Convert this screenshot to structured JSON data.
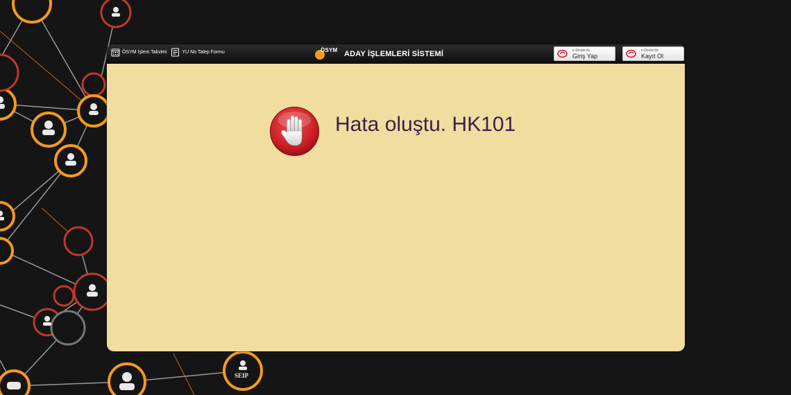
{
  "topbar": {
    "calendar_link": "ÖSYM İşlem Takvimi",
    "request_form_link": "YU No Talep Formu",
    "logo_text": "ÖSYM",
    "system_title": "ADAY İŞLEMLERİ SİSTEMİ",
    "edevlet_login": {
      "small": "e-Devlet ile",
      "label": "Giriş Yap"
    },
    "edevlet_register": {
      "small": "e-Devlet ile",
      "label": "Kayıt Ol"
    }
  },
  "error": {
    "icon": "stop-hand-icon",
    "message": "Hata oluştu. HK101"
  },
  "background": {
    "badge_text": "SEIP",
    "icons": [
      "network-node-icon",
      "person-icon"
    ]
  },
  "colors": {
    "page_bg": "#151515",
    "panel_bg": "#f1dd9f",
    "topbar_bg": "#1a1a1a",
    "accent_orange": "#f39a1e",
    "accent_red": "#c0392b",
    "error_text": "#3b1f4a"
  }
}
